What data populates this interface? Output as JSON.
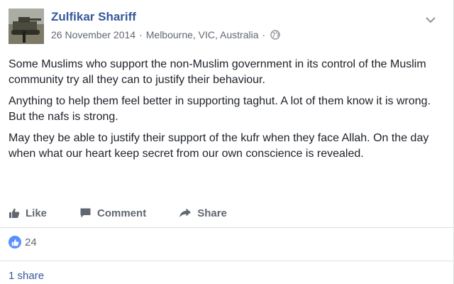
{
  "post": {
    "author": "Zulfikar Shariff",
    "date": "26 November 2014",
    "location": "Melbourne, VIC, Australia",
    "separator": "·",
    "privacy_icon": "globe-icon",
    "options_icon": "chevron-down-icon",
    "paragraphs": [
      "Some Muslims who support the non-Muslim government in its control of the Muslim community try all they can to justify their behaviour.",
      "Anything to help them feel better in supporting taghut. A lot of them know it is wrong. But the nafs is strong.",
      "May they be able to justify their support of the kufr when they face Allah. On the day when what our heart keep secret from our own conscience is revealed."
    ]
  },
  "actions": {
    "like": "Like",
    "comment": "Comment",
    "share": "Share"
  },
  "stats": {
    "reaction_icon": "thumbs-up-icon",
    "likes_count": "24",
    "shares": "1 share"
  },
  "colors": {
    "link": "#365899",
    "muted": "#606770",
    "like_badge": "#5890ff",
    "divider": "#dddfe2"
  }
}
